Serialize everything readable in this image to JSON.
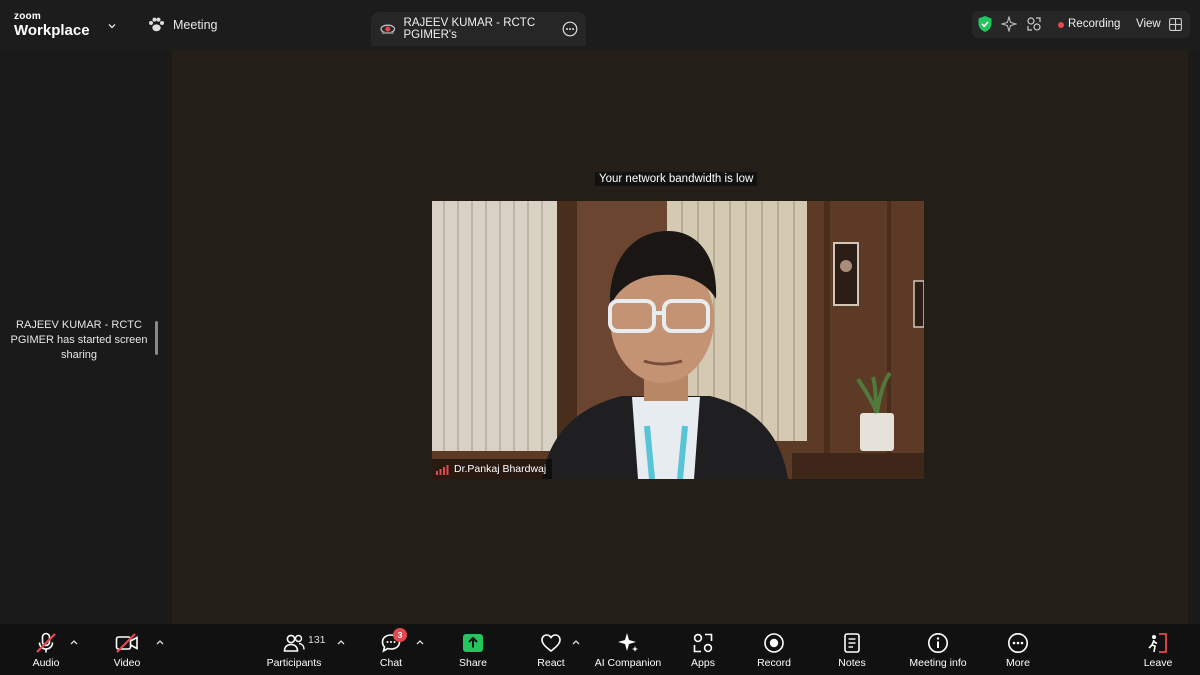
{
  "app": {
    "brand_top": "zoom",
    "brand_bottom": "Workplace",
    "meeting_menu_label": "Meeting"
  },
  "share_tab": {
    "title": "RAJEEV KUMAR - RCTC PGIMER's"
  },
  "status": {
    "recording_label": "Recording",
    "view_label": "View",
    "recording_color": "#e5484d",
    "secure_color": "#22c55e"
  },
  "sidebar": {
    "notice": "RAJEEV KUMAR - RCTC PGIMER has started screen sharing"
  },
  "stage": {
    "network_warning": "Your network bandwidth is low",
    "participant_name": "Dr.Pankaj Bhardwaj"
  },
  "toolbar": {
    "audio": "Audio",
    "video": "Video",
    "participants": "Participants",
    "participants_count": "131",
    "chat": "Chat",
    "chat_badge": "3",
    "share": "Share",
    "react": "React",
    "ai_companion": "AI Companion",
    "apps": "Apps",
    "record": "Record",
    "notes": "Notes",
    "meeting_info": "Meeting info",
    "more": "More",
    "leave": "Leave",
    "share_color": "#22c55e",
    "muted_color": "#e5484d"
  }
}
